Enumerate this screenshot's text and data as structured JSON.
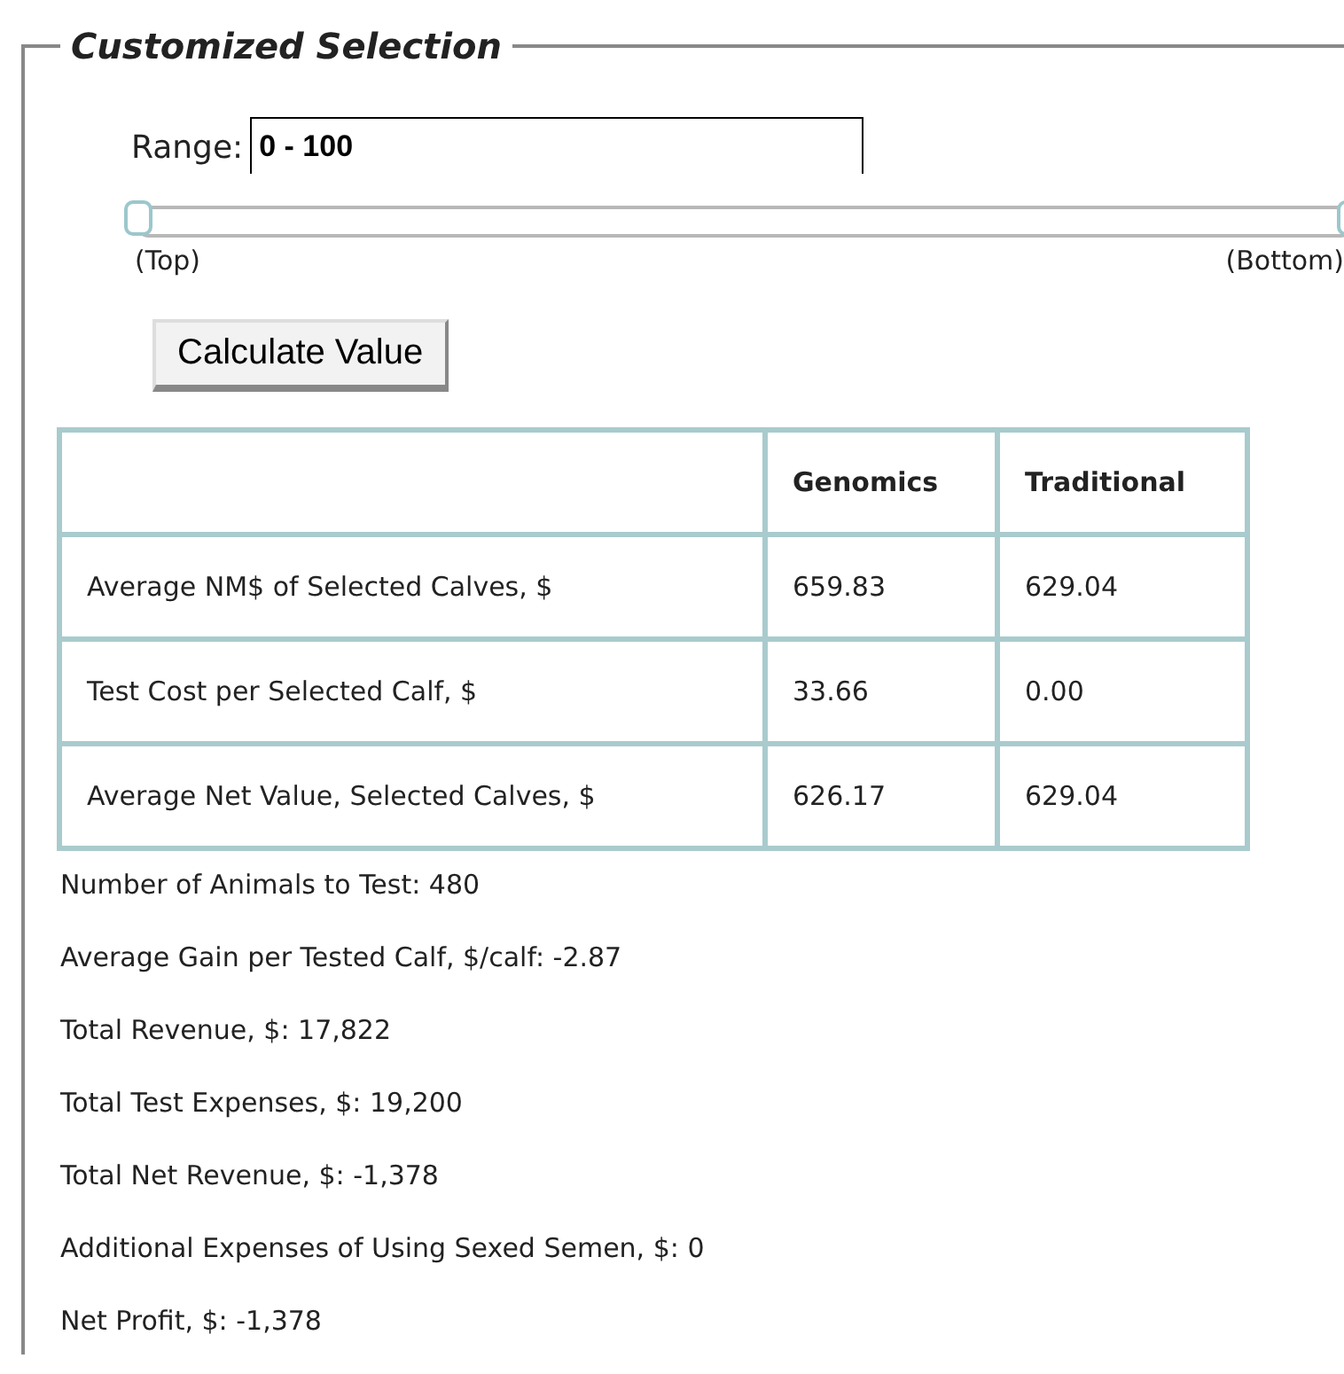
{
  "panel": {
    "title": "Customized Selection"
  },
  "range": {
    "label": "Range:",
    "value": "0 - 100"
  },
  "slider": {
    "handles": [
      {
        "level": 0
      },
      {
        "level": 1
      }
    ],
    "start_label": "(Top)",
    "end_label": "(Bottom)"
  },
  "calculate_button": "Calculate Value",
  "table": {
    "columns": [
      "",
      "Genomics",
      "Traditional"
    ],
    "rows": [
      [
        "Average NM$ of Selected Calves, $",
        "659.83",
        "629.04"
      ],
      [
        "Test Cost per Selected Calf, $",
        "33.66",
        "0.00"
      ],
      [
        "Average Net Value, Selected Calves, $",
        "626.17",
        "629.04"
      ]
    ]
  },
  "results": [
    "Number of Animals to Test: 480",
    "Average Gain per Tested Calf, $/calf: -2.87",
    "Total Revenue, $: 17,822",
    "Total Test Expenses, $: 19,200",
    "Total Net Revenue, $: -1,378",
    "Additional Expenses of Using Sexed Semen, $: 0",
    "Net Profit, $: -1,378"
  ]
}
